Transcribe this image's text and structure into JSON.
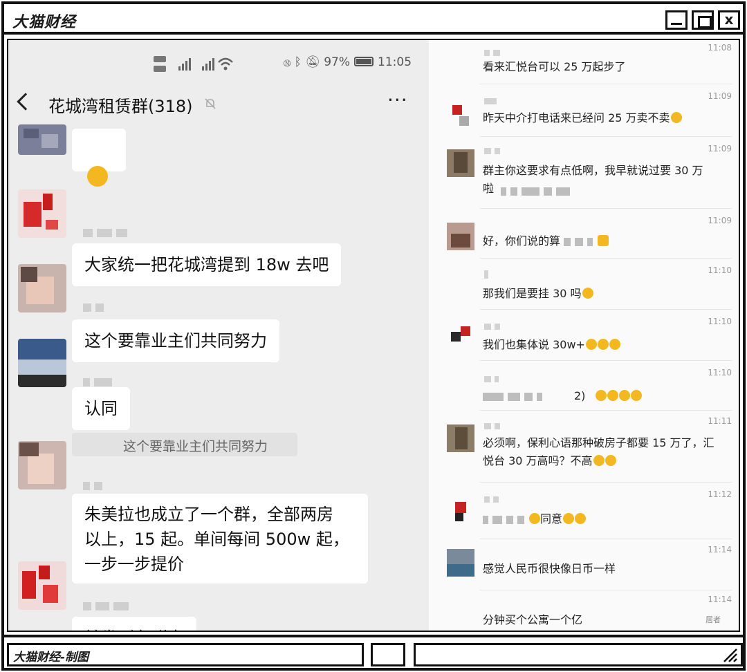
{
  "window": {
    "title": "大猫财经",
    "footer_label": "大猫财经-制图"
  },
  "phone": {
    "status": {
      "battery": "97%",
      "time": "11:05"
    },
    "chat_title": "花城湾租赁群(318)",
    "more": "···",
    "messages": [
      {
        "text": ""
      },
      {
        "text": "大家统一把花城湾提到 18w 去吧"
      },
      {
        "text": "这个要靠业主们共同努力"
      },
      {
        "text": "认同",
        "quote": "这个要靠业主们共同努力"
      },
      {
        "text": "朱美拉也成立了一个群，全部两房\n以上，15 起。单间每间 500w 起，\n一步一步提价"
      },
      {
        "text": "转发到各群去"
      }
    ]
  },
  "group_chat": {
    "messages": [
      {
        "time": "11:08",
        "text": "看来汇悦台可以 25 万起步了"
      },
      {
        "time": "11:09",
        "text": "昨天中介打电话来已经问 25 万卖不卖"
      },
      {
        "time": "11:09",
        "text": "群主你这要求有点低啊，我早就说过要 30 万\n啦"
      },
      {
        "time": "11:09",
        "text": "好，你们说的算"
      },
      {
        "time": "11:10",
        "text": "那我们是要挂 30 吗"
      },
      {
        "time": "11:10",
        "text": "我们也集体说 30w+"
      },
      {
        "time": "11:10",
        "text": "2)"
      },
      {
        "time": "11:11",
        "text": "必须啊，保利心语那种破房子都要 15 万了，汇\n悦台 30 万高吗？不高"
      },
      {
        "time": "11:12",
        "text": "同意"
      },
      {
        "time": "11:14",
        "text": "感觉人民币很快像日币一样"
      },
      {
        "time": "11:14",
        "text": "分钟买个公寓一个亿"
      }
    ],
    "watermark": "居者"
  },
  "colors": {
    "phone_bg": "#ededed",
    "bubble_bg": "#ffffff",
    "frame": "#111111",
    "emoji": "#f3b820"
  }
}
